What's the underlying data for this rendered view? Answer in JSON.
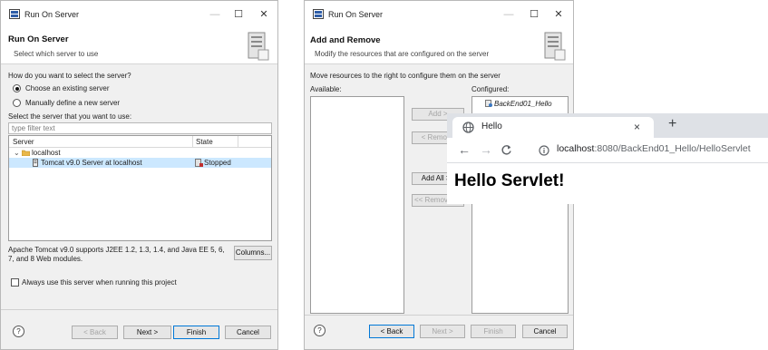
{
  "dialog1": {
    "window_title": "Run On Server",
    "header_title": "Run On Server",
    "header_subtitle": "Select which server to use",
    "question": "How do you want to select the server?",
    "radio_existing": "Choose an existing server",
    "radio_manual": "Manually define a new server",
    "select_label": "Select the server that you want to use:",
    "filter_placeholder": "type filter text",
    "table_headers": [
      "Server",
      "State"
    ],
    "tree_host": "localhost",
    "tree_server": "Tomcat v9.0 Server at localhost",
    "tree_state": "Stopped",
    "description": "Apache Tomcat v9.0 supports J2EE 1.2, 1.3, 1.4, and Java EE 5, 6, 7, and 8 Web modules.",
    "columns_button": "Columns...",
    "always_use": "Always use this server when running this project",
    "back_button": "< Back",
    "next_button": "Next >",
    "finish_button": "Finish",
    "cancel_button": "Cancel",
    "help": "?"
  },
  "dialog2": {
    "window_title": "Run On Server",
    "header_title": "Add and Remove",
    "header_subtitle": "Modify the resources that are configured on the server",
    "instruction": "Move resources to the right to configure them on the server",
    "available_label": "Available:",
    "configured_label": "Configured:",
    "configured_item": "BackEnd01_Hello",
    "add_button": "Add >",
    "remove_button": "< Remove",
    "add_all_button": "Add All >>",
    "remove_all_button": "<< Remove All",
    "back_button": "< Back",
    "next_button": "Next >",
    "finish_button": "Finish",
    "cancel_button": "Cancel",
    "help": "?"
  },
  "browser": {
    "tab_title": "Hello",
    "new_tab": "+",
    "close_tab": "×",
    "url_host": "localhost",
    "url_path": ":8080/BackEnd01_Hello/HelloServlet",
    "heading": "Hello Servlet!"
  },
  "colors": {
    "selection": "#cce8ff",
    "default_button_border": "#0078d7",
    "tabstrip": "#dee1e6"
  }
}
